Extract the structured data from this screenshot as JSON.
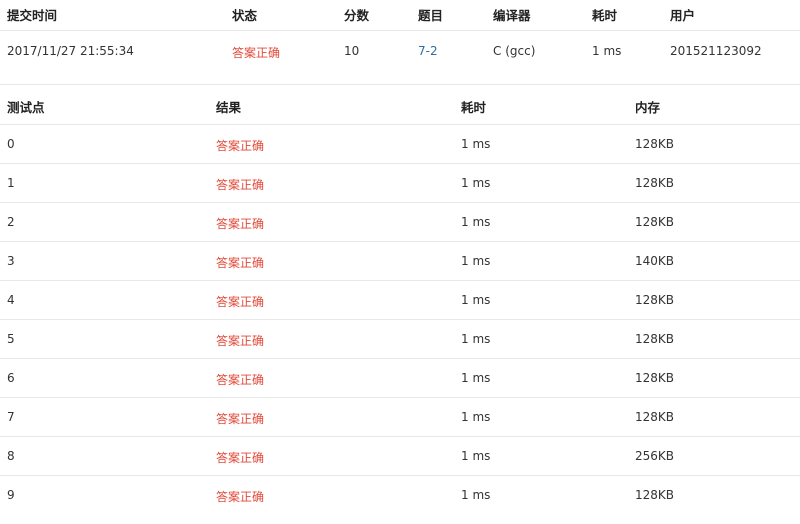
{
  "summary": {
    "headers": {
      "submit_time": "提交时间",
      "status": "状态",
      "score": "分数",
      "problem": "题目",
      "compiler": "编译器",
      "time_used": "耗时",
      "user": "用户"
    },
    "row": {
      "submit_time": "2017/11/27 21:55:34",
      "status": "答案正确",
      "score": "10",
      "problem": "7-2",
      "compiler": "C (gcc)",
      "time_used": "1 ms",
      "user": "201521123092"
    }
  },
  "testpoints": {
    "headers": {
      "index": "测试点",
      "result": "结果",
      "time": "耗时",
      "memory": "内存"
    },
    "rows": [
      {
        "index": "0",
        "result": "答案正确",
        "time": "1 ms",
        "memory": "128KB"
      },
      {
        "index": "1",
        "result": "答案正确",
        "time": "1 ms",
        "memory": "128KB"
      },
      {
        "index": "2",
        "result": "答案正确",
        "time": "1 ms",
        "memory": "128KB"
      },
      {
        "index": "3",
        "result": "答案正确",
        "time": "1 ms",
        "memory": "140KB"
      },
      {
        "index": "4",
        "result": "答案正确",
        "time": "1 ms",
        "memory": "128KB"
      },
      {
        "index": "5",
        "result": "答案正确",
        "time": "1 ms",
        "memory": "128KB"
      },
      {
        "index": "6",
        "result": "答案正确",
        "time": "1 ms",
        "memory": "128KB"
      },
      {
        "index": "7",
        "result": "答案正确",
        "time": "1 ms",
        "memory": "128KB"
      },
      {
        "index": "8",
        "result": "答案正确",
        "time": "1 ms",
        "memory": "256KB"
      },
      {
        "index": "9",
        "result": "答案正确",
        "time": "1 ms",
        "memory": "128KB"
      }
    ]
  },
  "colors": {
    "accepted": "#e04a3a",
    "link": "#2d6ea6",
    "border": "#e8e8e8"
  }
}
